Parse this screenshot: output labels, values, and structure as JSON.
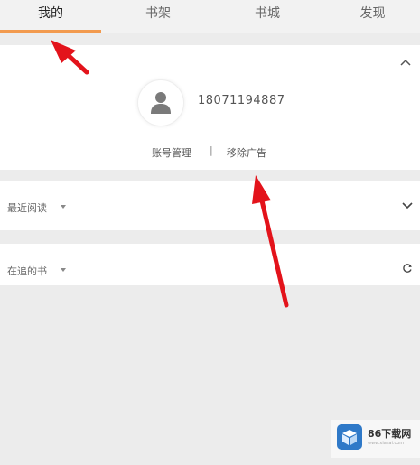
{
  "tabs": [
    {
      "label": "我的",
      "active": true
    },
    {
      "label": "书架",
      "active": false
    },
    {
      "label": "书城",
      "active": false
    },
    {
      "label": "发现",
      "active": false
    }
  ],
  "profile": {
    "phone": "18071194887",
    "account_manage": "账号管理",
    "separator": "|",
    "remove_ads": "移除广告"
  },
  "sections": {
    "recent_reading": "最近阅读",
    "following_books": "在追的书"
  },
  "watermark": {
    "title": "86下载网",
    "sub": "www.xiazai.com"
  },
  "colors": {
    "accent": "#f29a4e",
    "annotation_arrow": "#e3131b",
    "page_background": "#ececec"
  },
  "icons": {
    "collapse": "chevron-up-icon",
    "recent": "chevron-down-icon",
    "refresh": "refresh-icon",
    "avatar": "user-icon"
  }
}
